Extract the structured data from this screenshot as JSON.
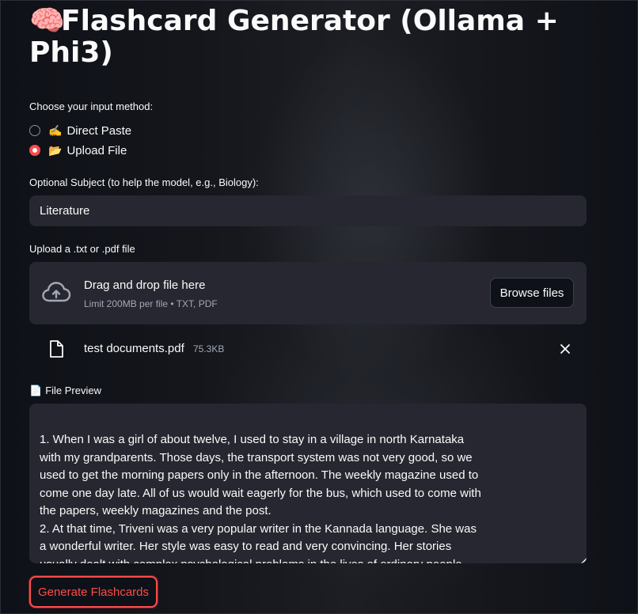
{
  "page": {
    "title_emoji": "🧠",
    "title": "Flashcard Generator (Ollama + Phi3)"
  },
  "input_method": {
    "label": "Choose your input method:",
    "options": [
      {
        "emoji": "✍️",
        "label": "Direct Paste",
        "selected": false
      },
      {
        "emoji": "📂",
        "label": "Upload File",
        "selected": true
      }
    ]
  },
  "subject": {
    "label": "Optional Subject (to help the model, e.g., Biology):",
    "value": "Literature"
  },
  "uploader": {
    "label": "Upload a .txt or .pdf file",
    "drop_title": "Drag and drop file here",
    "limit_text": "Limit 200MB per file • TXT, PDF",
    "browse_label": "Browse files",
    "icon": "cloud-upload-icon"
  },
  "uploaded_file": {
    "name": "test documents.pdf",
    "size": "75.3KB",
    "icon": "file-icon",
    "remove_icon": "close-icon"
  },
  "preview": {
    "label_emoji": "📄",
    "label": "File Preview",
    "text": "1. When I was a girl of about twelve, I used to stay in a village in north Karnataka with my grandparents. Those days, the transport system was not very good, so we used to get the morning papers only in the afternoon. The weekly magazine used to come one day late. All of us would wait eagerly for the bus, which used to come with the papers, weekly magazines and the post.\n2. At that time, Triveni was a very popular writer in the Kannada language. She was a wonderful writer. Her style was easy to read and very convincing. Her stories usually dealt with complex psychological problems in the lives of ordinary people"
  },
  "actions": {
    "generate_label": "Generate Flashcards"
  },
  "colors": {
    "background": "#0e1117",
    "widget": "#262730",
    "accent": "#ff4b4b",
    "text": "#fafafa",
    "muted": "#a3a8b4"
  }
}
